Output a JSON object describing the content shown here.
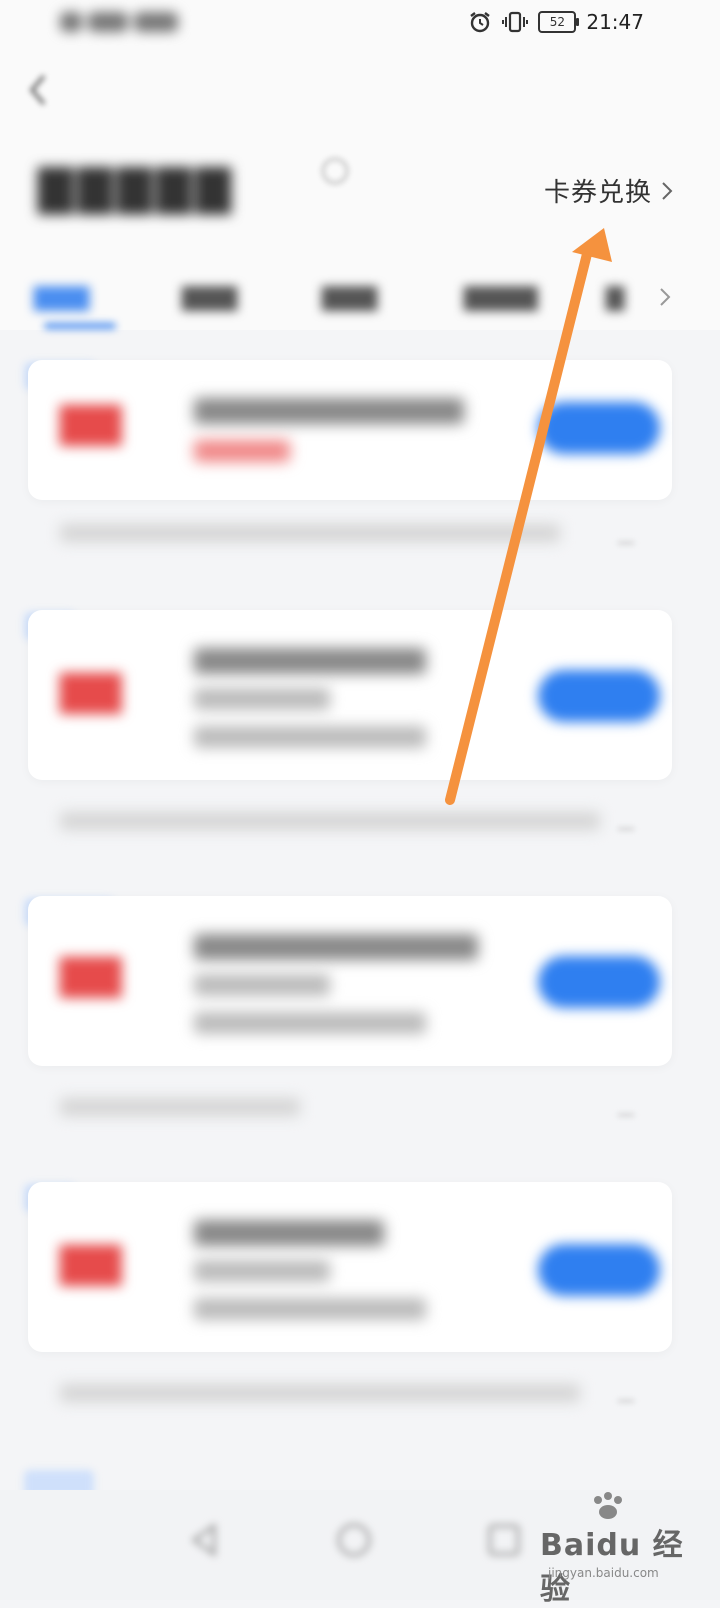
{
  "status_bar": {
    "time": "21:47",
    "battery": "52"
  },
  "header": {
    "exchange_label": "卡券兑换"
  },
  "watermark": {
    "brand": "Bai",
    "brand_cn": "du 经验",
    "site": "jingyan.baidu.com"
  },
  "colors": {
    "accent": "#2f7ff0",
    "arrow": "#f5923e",
    "price": "#e64b4b"
  },
  "icons": [
    "alarm-icon",
    "vibrate-icon",
    "battery-icon",
    "back-icon",
    "help-icon",
    "chevron-right-icon",
    "back-nav-icon",
    "home-nav-icon",
    "recent-nav-icon"
  ]
}
